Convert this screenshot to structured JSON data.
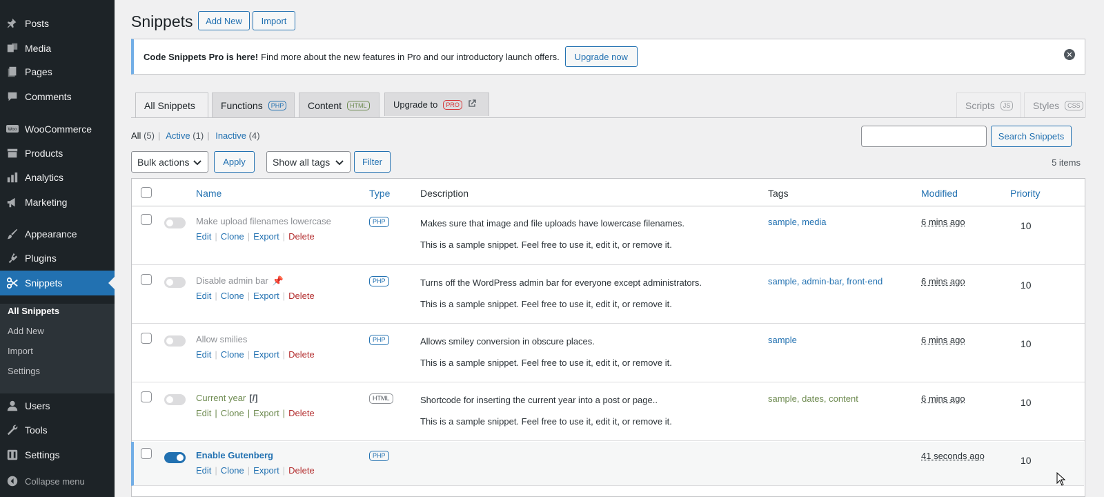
{
  "sidebar": {
    "items": [
      {
        "label": "Posts",
        "icon": "pin-icon"
      },
      {
        "label": "Media",
        "icon": "media-icon"
      },
      {
        "label": "Pages",
        "icon": "pages-icon"
      },
      {
        "label": "Comments",
        "icon": "comment-icon"
      },
      {
        "label": "WooCommerce",
        "icon": "woocommerce-icon"
      },
      {
        "label": "Products",
        "icon": "archive-icon"
      },
      {
        "label": "Analytics",
        "icon": "chart-bar-icon"
      },
      {
        "label": "Marketing",
        "icon": "megaphone-icon"
      },
      {
        "label": "Appearance",
        "icon": "paintbrush-icon"
      },
      {
        "label": "Plugins",
        "icon": "plugin-icon"
      },
      {
        "label": "Snippets",
        "icon": "scissors-icon"
      },
      {
        "label": "Users",
        "icon": "users-icon"
      },
      {
        "label": "Tools",
        "icon": "wrench-icon"
      },
      {
        "label": "Settings",
        "icon": "settings-icon"
      }
    ],
    "submenu": [
      "All Snippets",
      "Add New",
      "Import",
      "Settings"
    ],
    "collapse": "Collapse menu"
  },
  "header": {
    "title": "Snippets",
    "add_new": "Add New",
    "import": "Import"
  },
  "notice": {
    "bold": "Code Snippets Pro is here!",
    "text": " Find more about the new features in Pro and our introductory launch offers.",
    "button": "Upgrade now"
  },
  "tabs": {
    "all": "All Snippets",
    "functions": "Functions",
    "functions_badge": "PHP",
    "content": "Content",
    "content_badge": "HTML",
    "upgrade": "Upgrade to",
    "upgrade_badge": "PRO",
    "scripts": "Scripts",
    "scripts_badge": "JS",
    "styles": "Styles",
    "styles_badge": "CSS"
  },
  "filters": {
    "all": "All",
    "all_count": "(5)",
    "active": "Active",
    "active_count": "(1)",
    "inactive": "Inactive",
    "inactive_count": "(4)"
  },
  "toolbar": {
    "search_button": "Search Snippets",
    "bulk": "Bulk actions",
    "apply": "Apply",
    "tags": "Show all tags",
    "filter": "Filter",
    "items": "5 items"
  },
  "table": {
    "headers": {
      "name": "Name",
      "type": "Type",
      "description": "Description",
      "tags": "Tags",
      "modified": "Modified",
      "priority": "Priority"
    },
    "actions": {
      "edit": "Edit",
      "clone": "Clone",
      "export": "Export",
      "delete": "Delete"
    },
    "sample_note": "This is a sample snippet. Feel free to use it, edit it, or remove it.",
    "rows": [
      {
        "name": "Make upload filenames lowercase",
        "type": "PHP",
        "description": "Makes sure that image and file uploads have lowercase filenames.",
        "tags": "sample, media",
        "modified": "6 mins ago",
        "priority": "10"
      },
      {
        "name": "Disable admin bar",
        "type": "PHP",
        "description": "Turns off the WordPress admin bar for everyone except administrators.",
        "tags": "sample, admin-bar, front-end",
        "modified": "6 mins ago",
        "priority": "10"
      },
      {
        "name": "Allow smilies",
        "type": "PHP",
        "description": "Allows smiley conversion in obscure places.",
        "tags": "sample",
        "modified": "6 mins ago",
        "priority": "10"
      },
      {
        "name": "Current year",
        "shortcode": "[/]",
        "type": "HTML",
        "description": "Shortcode for inserting the current year into a post or page..",
        "tags": "sample, dates, content",
        "modified": "6 mins ago",
        "priority": "10"
      },
      {
        "name": "Enable Gutenberg",
        "type": "PHP",
        "description": "",
        "tags": "",
        "modified": "41 seconds ago",
        "priority": "10"
      }
    ]
  }
}
